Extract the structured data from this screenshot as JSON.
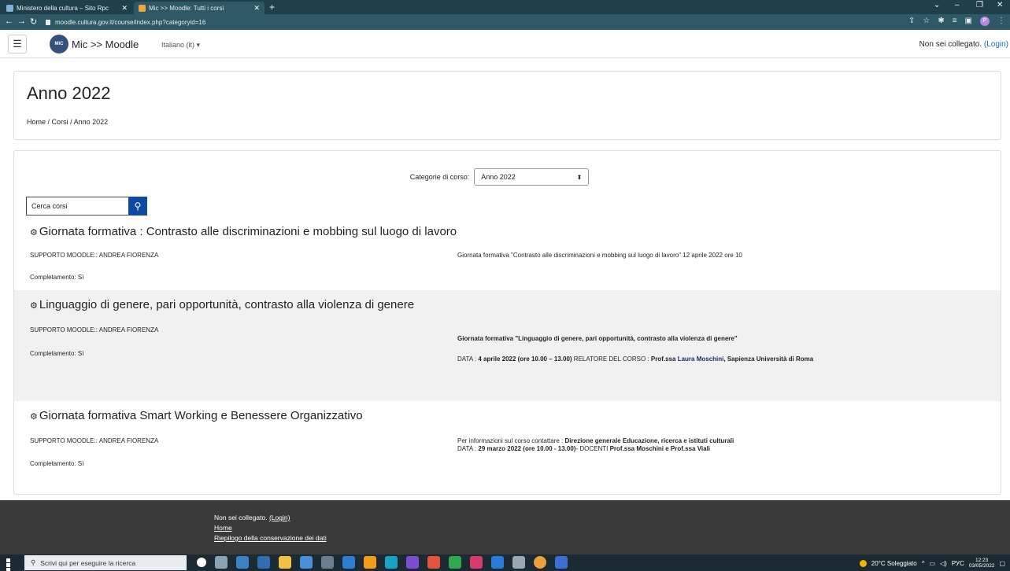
{
  "browser": {
    "tabs": [
      {
        "label": "Ministero della cultura – Sito Rpc"
      },
      {
        "label": "Mic >> Moodle: Tutti i corsi"
      }
    ],
    "new_tab": "+",
    "url": "moodle.cultura.gov.it/course/index.php?categoryid=16",
    "profile_initial": "P"
  },
  "navbar": {
    "brand": "Mic >> Moodle",
    "language": "Italiano (it) ▾",
    "login_text": "Non sei collegato. ",
    "login_link": "(Login)"
  },
  "header": {
    "title": "Anno 2022",
    "breadcrumb": [
      "Home",
      "Corsi",
      "Anno 2022"
    ]
  },
  "categories": {
    "label": "Categorie di corso:",
    "selected": "Anno 2022"
  },
  "search": {
    "placeholder": "Cerca corsi"
  },
  "courses": [
    {
      "title": "Giornata formativa : Contrasto alle discriminazioni e mobbing sul luogo di lavoro",
      "contact": "SUPPORTO MOODLE:: ANDREA FIORENZA",
      "completion": "Completamento: Sì",
      "summary1": "Giornata formativa \"Contrasto alle discriminazioni e mobbing sul luogo di lavoro\" 12 aprile 2022 ore 10"
    },
    {
      "title": "Linguaggio di genere, pari opportunità, contrasto alla violenza di genere",
      "contact": "SUPPORTO MOODLE:: ANDREA FIORENZA",
      "completion": "Completamento: Sì",
      "summary1": "Giornata formativa \"Linguaggio di genere, pari opportunità, contrasto alla violenza di genere\"",
      "summary2_prefix": "DATA : ",
      "summary2_date": "4 aprile 2022 (ore 10.00 – 13.00)",
      "summary2_mid": "  RELATORE DEL CORSO : ",
      "summary2_speaker_a": "Prof.ssa ",
      "summary2_speaker_b": "Laura Moschini",
      "summary2_tail": ", Sapienza Università di Roma"
    },
    {
      "title": "Giornata formativa Smart Working e Benessere Organizzativo",
      "contact": "SUPPORTO MOODLE:: ANDREA FIORENZA",
      "completion": "Completamento: Sì",
      "summary1_prefix": "Per informazioni sul corso contattare : ",
      "summary1_bold": "Direzione generale Educazione, ricerca e istituti culturali",
      "summary2_prefix": "DATA : ",
      "summary2_date": "29 marzo 2022 (ore 10.00 - 13.00)",
      "summary2_mid": "-  DOCENTI ",
      "summary2_teachers": "Prof.ssa Moschini e Prof.ssa Viali"
    }
  ],
  "footer": {
    "login_text": "Non sei collegato. ",
    "login_link": "(Login)",
    "home": "Home",
    "data_retention": "Riepilogo della conservazione dei dati"
  },
  "taskbar": {
    "search_placeholder": "Scrivi qui per eseguire la ricerca",
    "weather": "20°C  Soleggiato",
    "lang": "РУС",
    "time": "12:23",
    "date": "03/05/2022"
  }
}
